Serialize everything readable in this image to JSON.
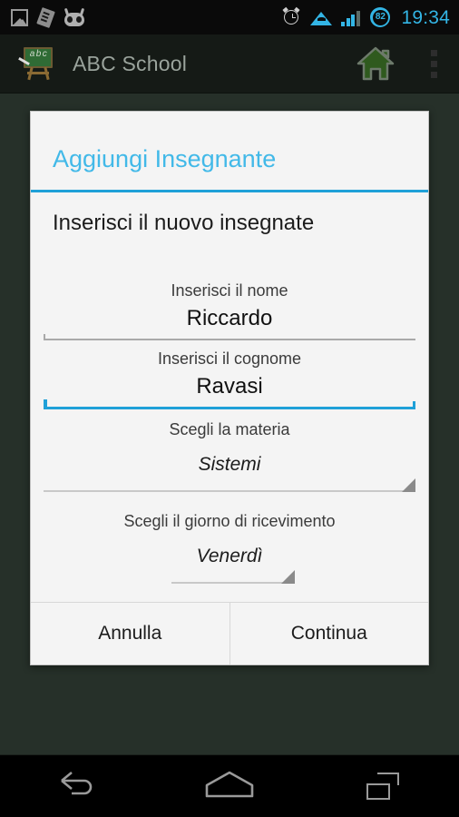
{
  "statusbar": {
    "time": "19:34",
    "battery_percent": "82",
    "icons_left": [
      "gallery-icon",
      "document-icon",
      "cyanogenmod-icon"
    ],
    "icons_right": [
      "alarm-icon",
      "wifi-icon",
      "cellular-signal-icon",
      "battery-icon"
    ],
    "accent_color": "#33b5e5"
  },
  "actionbar": {
    "app_icon": "chalkboard-abc-icon",
    "title": "ABC School",
    "home_icon": "house-icon",
    "overflow_icon": "overflow-menu-icon",
    "home_color": "#2f5a1e"
  },
  "dialog": {
    "title": "Aggiungi Insegnante",
    "title_color": "#42b9e8",
    "accent_color": "#1fa0d8",
    "heading": "Inserisci il nuovo insegnate",
    "fields": [
      {
        "label": "Inserisci il nome",
        "value": "Riccardo",
        "placeholder": "Inserisci il nome",
        "focused": false
      },
      {
        "label": "Inserisci il cognome",
        "value": "Ravasi",
        "placeholder": "Inserisci il cognome",
        "focused": true
      }
    ],
    "spinners": [
      {
        "label": "Scegli la materia",
        "value": "Sistemi",
        "arrow_icon": "dropdown-triangle-icon"
      },
      {
        "label": "Scegli il giorno di ricevimento",
        "value": "Venerdì",
        "arrow_icon": "dropdown-triangle-icon"
      }
    ],
    "buttons": {
      "cancel": "Annulla",
      "continue": "Continua"
    }
  },
  "navbar": {
    "back_icon": "back-arrow-icon",
    "home_icon": "home-icon",
    "recents_icon": "recents-icon"
  }
}
